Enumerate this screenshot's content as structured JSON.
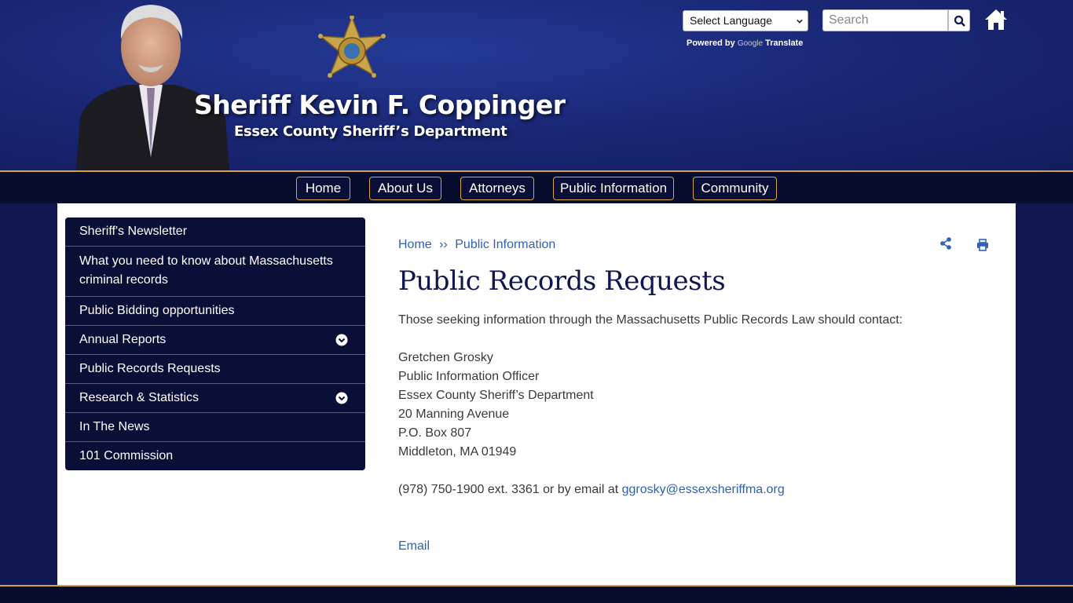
{
  "header": {
    "title": "Sheriff Kevin F. Coppinger",
    "subtitle": "Essex County Sheriff’s Department",
    "language_select": "Select Language",
    "powered_by": "Powered by",
    "google": "Google",
    "translate": "Translate",
    "search_placeholder": "Search"
  },
  "nav": {
    "items": [
      {
        "label": "Home"
      },
      {
        "label": "About Us"
      },
      {
        "label": "Attorneys"
      },
      {
        "label": "Public Information"
      },
      {
        "label": "Community"
      }
    ]
  },
  "sidebar": {
    "items": [
      {
        "label": "Sheriff's Newsletter"
      },
      {
        "label": "What you need to know about Massachusetts criminal records"
      },
      {
        "label": "Public Bidding opportunities"
      },
      {
        "label": "Annual Reports"
      },
      {
        "label": "Public Records Requests"
      },
      {
        "label": "Research & Statistics"
      },
      {
        "label": "In The News"
      },
      {
        "label": "101 Commission"
      }
    ]
  },
  "breadcrumb": {
    "home": "Home",
    "separator": "››",
    "current": "Public Information"
  },
  "content": {
    "title": "Public Records Requests",
    "intro": "Those seeking information through the Massachusetts Public Records Law should contact:",
    "contact_lines": [
      "Gretchen Grosky",
      "Public Information Officer",
      "Essex County Sheriff’s Department",
      "20 Manning Avenue",
      "P.O. Box 807",
      "Middleton, MA 01949"
    ],
    "phone_text": "(978) 750-1900 ext. 3361 or by email at ",
    "email": "ggrosky@essexsheriffma.org",
    "email_link": "Email"
  },
  "colors": {
    "navy": "#0f1650",
    "gold": "#d9a43a",
    "link": "#3060b8"
  }
}
